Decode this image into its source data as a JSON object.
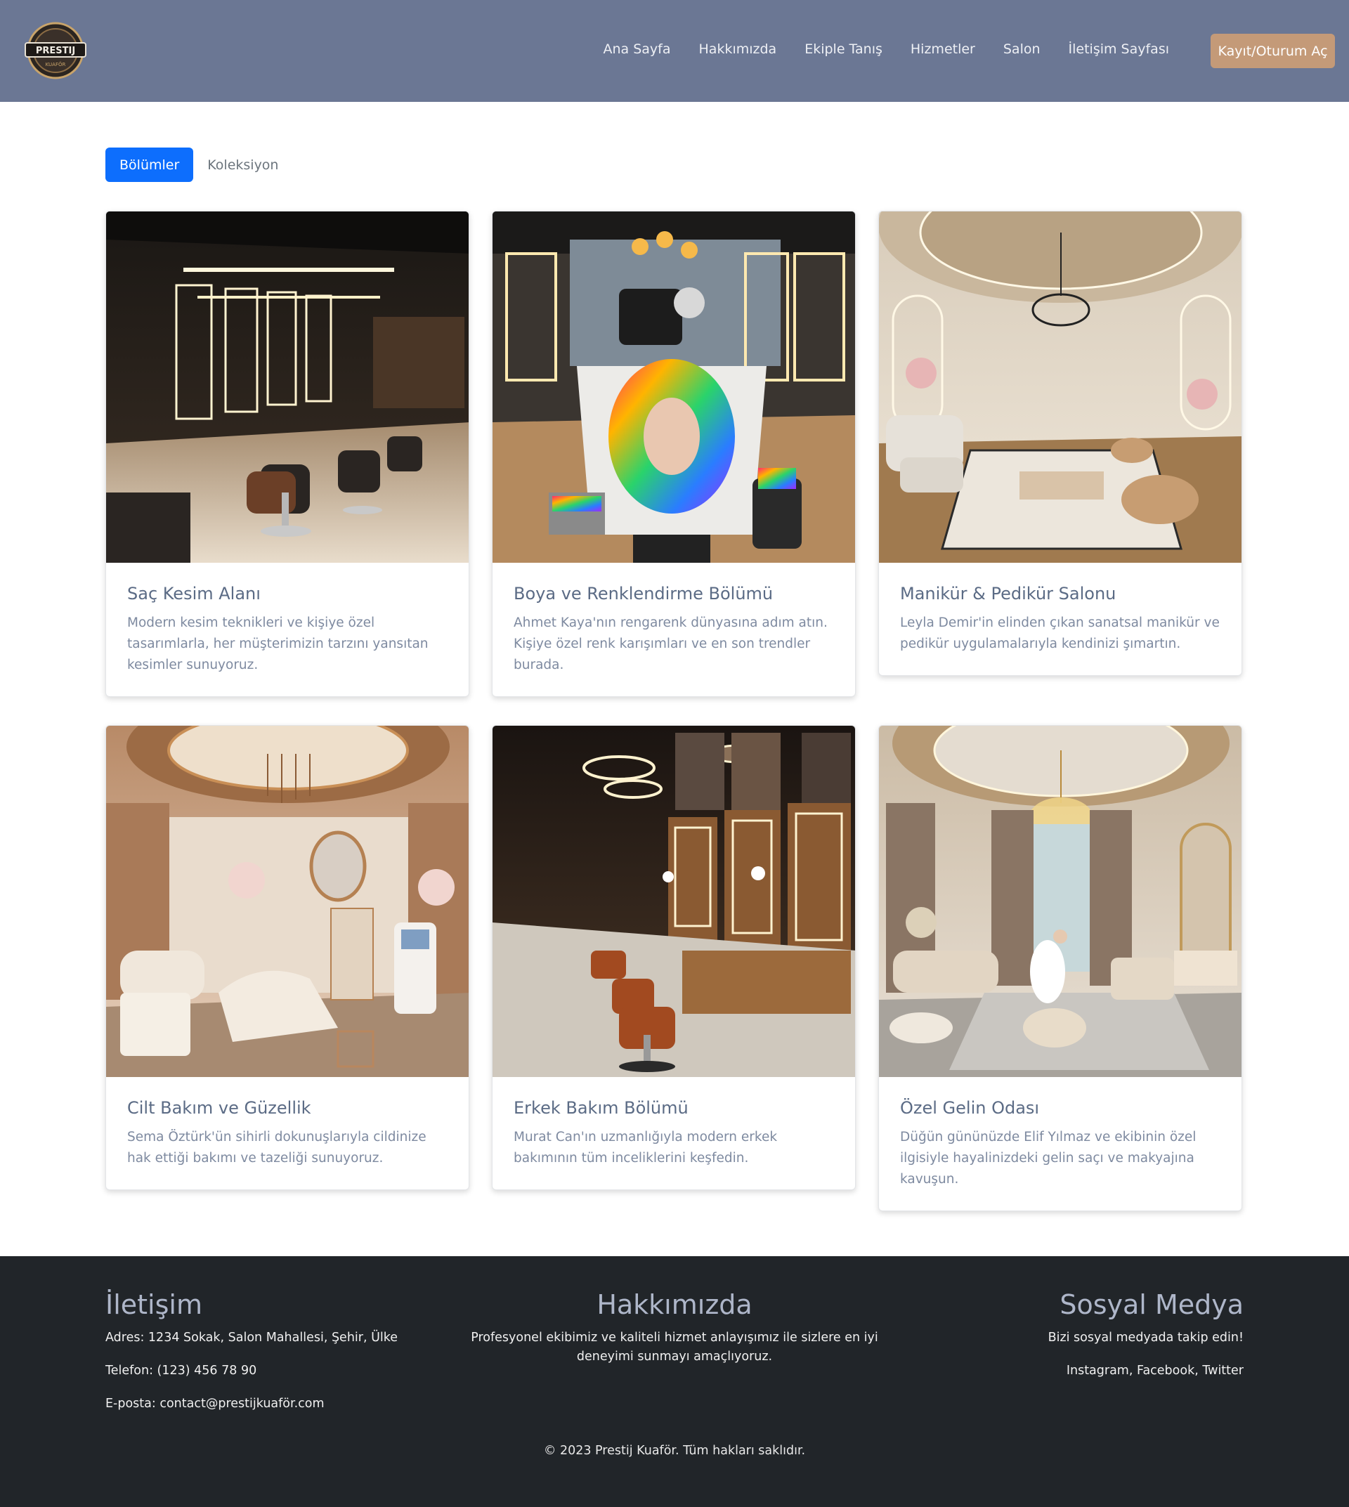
{
  "brand": {
    "logo_text": "PRESTIJ",
    "logo_subtext": "KUAFÖR"
  },
  "nav": {
    "links": [
      "Ana Sayfa",
      "Hakkımızda",
      "Ekiple Tanış",
      "Hizmetler",
      "Salon",
      "İletişim Sayfası"
    ],
    "cta": "Kayıt/Oturum Aç"
  },
  "tabs": {
    "active": "Bölümler",
    "inactive": "Koleksiyon"
  },
  "cards": [
    {
      "title": "Saç Kesim Alanı",
      "text": "Modern kesim teknikleri ve kişiye özel tasarımlarla, her müşterimizin tarzını yansıtan kesimler sunuyoruz."
    },
    {
      "title": "Boya ve Renklendirme Bölümü",
      "text": "Ahmet Kaya'nın rengarenk dünyasına adım atın. Kişiye özel renk karışımları ve en son trendler burada."
    },
    {
      "title": "Manikür & Pedikür Salonu",
      "text": "Leyla Demir'in elinden çıkan sanatsal manikür ve pedikür uygulamalarıyla kendinizi şımartın."
    },
    {
      "title": "Cilt Bakım ve Güzellik",
      "text": "Sema Öztürk'ün sihirli dokunuşlarıyla cildinize hak ettiği bakımı ve tazeliği sunuyoruz."
    },
    {
      "title": "Erkek Bakım Bölümü",
      "text": "Murat Can'ın uzmanlığıyla modern erkek bakımının tüm inceliklerini keşfedin."
    },
    {
      "title": "Özel Gelin Odası",
      "text": "Düğün gününüzde Elif Yılmaz ve ekibinin özel ilgisiyle hayalinizdeki gelin saçı ve makyajına kavuşun."
    }
  ],
  "footer": {
    "contact": {
      "title": "İletişim",
      "address": "Adres: 1234 Sokak, Salon Mahallesi, Şehir, Ülke",
      "phone": "Telefon: (123) 456 78 90",
      "email": "E-posta: contact@prestijkuaför.com"
    },
    "about": {
      "title": "Hakkımızda",
      "line1": "Profesyonel ekibimiz ve kaliteli hizmet anlayışımız ile sizlere en iyi",
      "line2": "deneyimi sunmayı amaçlıyoruz."
    },
    "social": {
      "title": "Sosyal Medya",
      "tagline": "Bizi sosyal medyada takip edin!",
      "links": "Instagram, Facebook, Twitter"
    },
    "copyright": "© 2023 Prestij Kuaför. Tüm hakları saklıdır."
  },
  "colors": {
    "navbar": "#6b7794",
    "accent_button": "#c49a78",
    "tab_active": "#0d6efd",
    "footer": "#212529"
  }
}
